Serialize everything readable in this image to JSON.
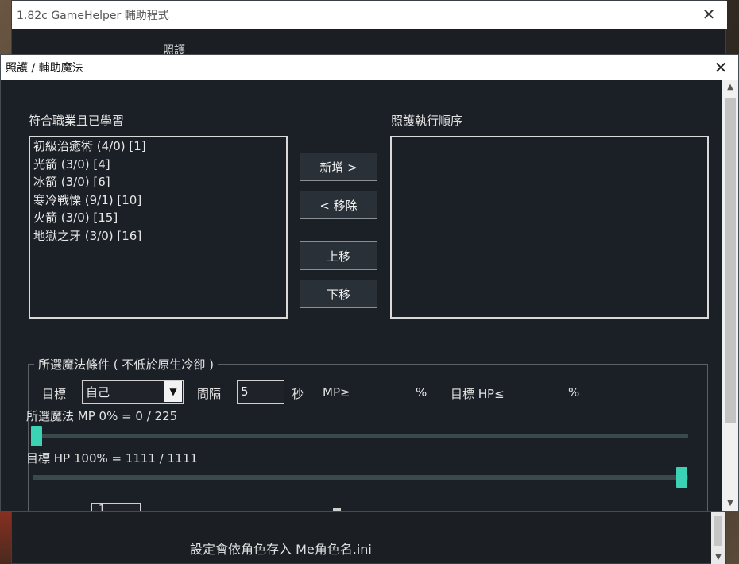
{
  "back_window": {
    "title": "1.82c GameHelper 輔助程式",
    "tab_label": "照護",
    "footer_text": "設定會依角色存入 Me角色名.ini"
  },
  "dialog": {
    "title": "照護 / 輔助魔法",
    "learned": {
      "label": "符合職業且已學習",
      "items": [
        "初級治癒術 (4/0)  [1]",
        "光箭 (3/0)  [4]",
        "冰箭 (3/0)  [6]",
        "寒冷戰慄 (9/1)  [10]",
        "火箭 (3/0)  [15]",
        "地獄之牙 (3/0)  [16]"
      ]
    },
    "order": {
      "label": "照護執行順序",
      "items": []
    },
    "buttons": {
      "add": "新增 >",
      "remove": "< 移除",
      "up": "上移",
      "down": "下移"
    },
    "conditions": {
      "group_title": "所選魔法條件 ( 不低於原生冷卻 )",
      "target_label": "目標",
      "target_value": "自己",
      "interval_label": "間隔",
      "interval_value": "5",
      "seconds_label": "秒",
      "mp_label": "MP≥",
      "mp_percent": "%",
      "target_hp_label": "目標 HP≤",
      "hp_percent": "%",
      "mp_status": "所選魔法 MP  0% = 0 / 225",
      "mp_slider_value": 0,
      "hp_status": "目標 HP  100% = 1111 / 1111",
      "hp_slider_value": 100,
      "partial_field_value": "1"
    }
  },
  "colors": {
    "accent": "#3cd2b4",
    "dialog_bg": "#1b2026"
  }
}
